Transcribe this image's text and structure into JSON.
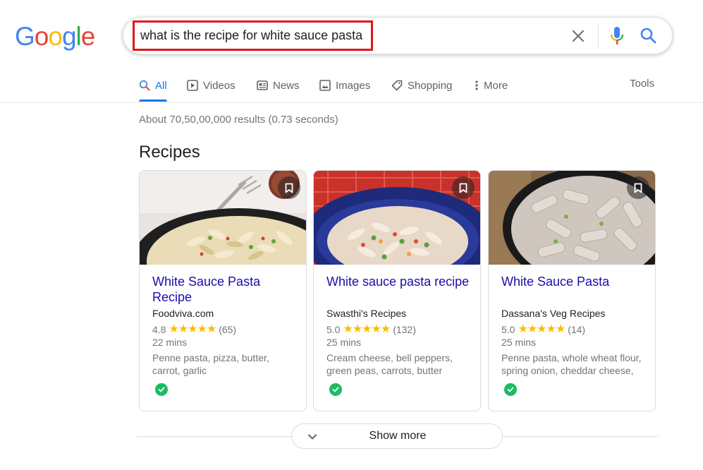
{
  "logo": {
    "letters": [
      "G",
      "o",
      "o",
      "g",
      "l",
      "e"
    ],
    "colors": [
      "#4285f4",
      "#ea4335",
      "#fbbc05",
      "#4285f4",
      "#34a853",
      "#ea4335"
    ]
  },
  "search": {
    "query": "what is the recipe for white sauce pasta"
  },
  "tabs": [
    {
      "label": "All",
      "icon": "search-icon",
      "active": true
    },
    {
      "label": "Videos",
      "icon": "play-icon"
    },
    {
      "label": "News",
      "icon": "newspaper-icon"
    },
    {
      "label": "Images",
      "icon": "image-icon"
    },
    {
      "label": "Shopping",
      "icon": "tag-icon"
    },
    {
      "label": "More",
      "icon": "more-vert-icon"
    }
  ],
  "tools_label": "Tools",
  "result_stats": "About 70,50,00,000 results (0.73 seconds)",
  "section_title": "Recipes",
  "recipes": [
    {
      "title": "White Sauce Pasta Recipe",
      "source": "Foodviva.com",
      "rating": "4.8",
      "stars": "★★★★★",
      "reviews": "(65)",
      "time": "22 mins",
      "ingredients": "Penne pasta, pizza, butter, carrot, garlic"
    },
    {
      "title": "White sauce pasta recipe",
      "source": "Swasthi's Recipes",
      "rating": "5.0",
      "stars": "★★★★★",
      "reviews": "(132)",
      "time": "25 mins",
      "ingredients": "Cream cheese, bell peppers, green peas, carrots, butter"
    },
    {
      "title": "White Sauce Pasta",
      "source": "Dassana's Veg Recipes",
      "rating": "5.0",
      "stars": "★★★★★",
      "reviews": "(14)",
      "time": "25 mins",
      "ingredients": "Penne pasta, whole wheat flour, spring onion, cheddar cheese,"
    }
  ],
  "show_more_label": "Show more",
  "colors": {
    "link": "#1a0dab",
    "accent": "#1a73e8",
    "star": "#fbbc04",
    "highlight_box": "#e3141d",
    "verified": "#1dbb64"
  }
}
